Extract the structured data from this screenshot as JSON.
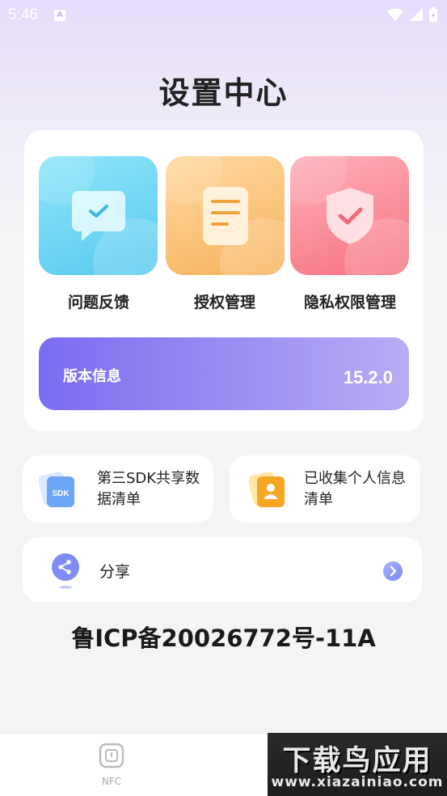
{
  "status_bar": {
    "time": "5:46",
    "icons": [
      "notification-a-icon",
      "wifi-icon",
      "signal-icon",
      "battery-icon"
    ]
  },
  "page": {
    "title": "设置中心"
  },
  "tiles": [
    {
      "label": "问题反馈",
      "icon": "chat-check-icon",
      "color": "#56c9ef"
    },
    {
      "label": "授权管理",
      "icon": "document-icon",
      "color": "#f7b25a"
    },
    {
      "label": "隐私权限管理",
      "icon": "shield-check-icon",
      "color": "#f5727f"
    }
  ],
  "version": {
    "label": "版本信息",
    "number": "15.2.0"
  },
  "list_cards": [
    {
      "label": "第三SDK共享数据清单",
      "icon": "sdk-icon"
    },
    {
      "label": "已收集个人信息清单",
      "icon": "person-card-icon"
    }
  ],
  "share": {
    "label": "分享",
    "icon": "share-icon"
  },
  "icp": "鲁ICP备20026772号-11A",
  "bottom_nav": {
    "nfc_label": "NFC"
  },
  "watermark": {
    "main": "下载鸟应用",
    "sub": "www.xiazainiao.com"
  }
}
